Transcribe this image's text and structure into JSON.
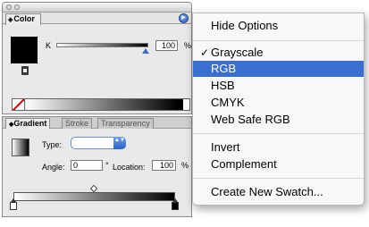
{
  "color_panel": {
    "tab_label": "Color",
    "tab_arrows": "◆",
    "k_label": "K",
    "k_value": "100",
    "k_unit": "%",
    "k_level": 1.0,
    "menu_button_glyph": "▶"
  },
  "gradient_panel": {
    "tabs": [
      {
        "label": "Gradient"
      },
      {
        "label": "Stroke"
      },
      {
        "label": "Transparency"
      }
    ],
    "type_label": "Type:",
    "type_arrow": "▲▼",
    "angle_label": "Angle:",
    "angle_value": "0",
    "degree_symbol": "°",
    "location_label": "Location:",
    "location_value": "100",
    "location_unit": "%"
  },
  "menu": {
    "items": [
      {
        "label": "Hide Options"
      },
      {
        "label": "Grayscale",
        "checked": true
      },
      {
        "label": "RGB",
        "selected": true
      },
      {
        "label": "HSB"
      },
      {
        "label": "CMYK"
      },
      {
        "label": "Web Safe RGB"
      },
      {
        "label": "Invert"
      },
      {
        "label": "Complement"
      },
      {
        "label": "Create New Swatch..."
      }
    ],
    "check_glyph": "✓"
  },
  "colors": {
    "selection": "#3a6fcf",
    "none_slash": "#d00000"
  }
}
